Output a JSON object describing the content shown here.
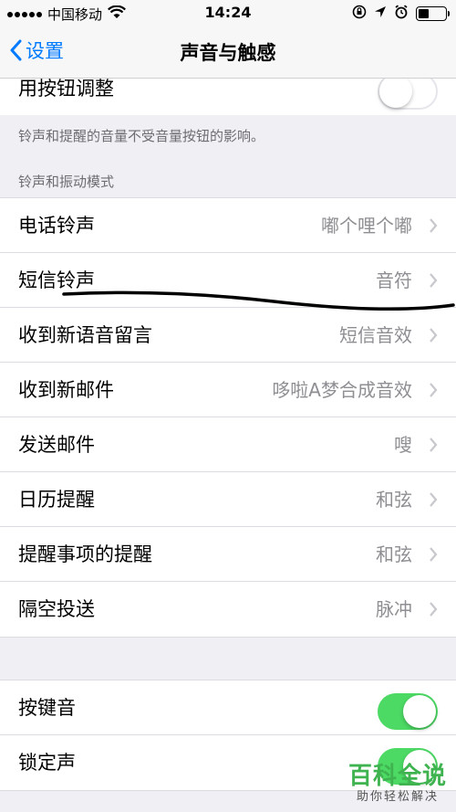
{
  "status_bar": {
    "carrier": "中国移动",
    "time": "14:24"
  },
  "nav": {
    "back_label": "设置",
    "title": "声音与触感"
  },
  "top_row": {
    "label": "用按钮调整",
    "toggle_on": false
  },
  "top_footer": "铃声和提醒的音量不受音量按钮的影响。",
  "sounds_section": {
    "header": "铃声和振动模式",
    "rows": [
      {
        "label": "电话铃声",
        "value": "嘟个哩个嘟"
      },
      {
        "label": "短信铃声",
        "value": "音符"
      },
      {
        "label": "收到新语音留言",
        "value": "短信音效"
      },
      {
        "label": "收到新邮件",
        "value": "哆啦A梦合成音效"
      },
      {
        "label": "发送邮件",
        "value": "嗖"
      },
      {
        "label": "日历提醒",
        "value": "和弦"
      },
      {
        "label": "提醒事项的提醒",
        "value": "和弦"
      },
      {
        "label": "隔空投送",
        "value": "脉冲"
      }
    ]
  },
  "bottom_section": {
    "rows": [
      {
        "label": "按键音",
        "toggle_on": true
      },
      {
        "label": "锁定声",
        "toggle_on": true
      }
    ]
  },
  "watermark": {
    "main": "百科全说",
    "sub": "助你轻松解决"
  },
  "colors": {
    "accent": "#007aff",
    "toggle_on": "#4cd964",
    "watermark": "#3fb34f"
  }
}
